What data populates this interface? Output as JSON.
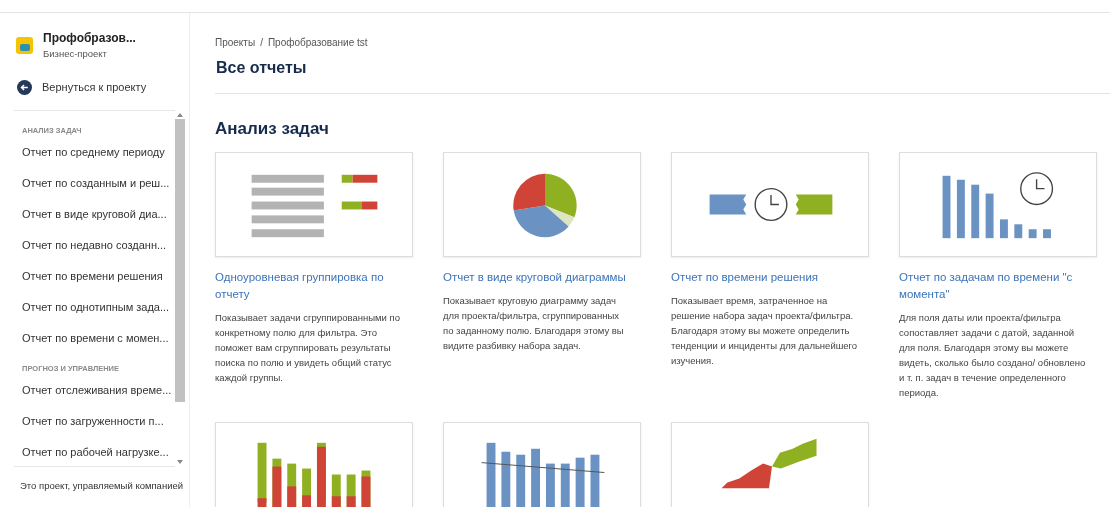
{
  "project": {
    "name": "Профобразов...",
    "type": "Бизнес-проект"
  },
  "back_link": "Вернуться к проекту",
  "sidebar": {
    "sections": [
      {
        "heading": "АНАЛИЗ ЗАДАЧ",
        "items": [
          "Отчет по среднему периоду",
          "Отчет по созданным и реш...",
          "Отчет в виде круговой диа...",
          "Отчет по недавно созданн...",
          "Отчет по времени решения",
          "Отчет по однотипным зада...",
          "Отчет по времени с момен..."
        ]
      },
      {
        "heading": "ПРОГНОЗ И УПРАВЛЕНИЕ",
        "items": [
          "Отчет отслеживания време...",
          "Отчет по загруженности п...",
          "Отчет по рабочей нагрузке..."
        ]
      }
    ],
    "footer": "Это проект, управляемый компанией"
  },
  "breadcrumbs": [
    "Проекты",
    "Профобразование tst"
  ],
  "breadcrumb_separator": "/",
  "page_title": "Все отчеты",
  "section_title": "Анализ задач",
  "cards": [
    {
      "kind": "grouping",
      "title": "Одноуровневая группировка по отчету",
      "description": "Показывает задачи сгруппированными по конкретному полю для фильтра. Это поможет вам сгруппировать результаты поиска по полю и увидеть общий статус каждой группы."
    },
    {
      "kind": "pie",
      "title": "Отчет в виде круговой диаграммы",
      "description": "Показывает круговую диаграмму задач для проекта/фильтра, сгруппированных по заданному полю. Благодаря этому вы видите разбивку набора задач."
    },
    {
      "kind": "resolution",
      "title": "Отчет по времени решения",
      "description": "Показывает время, затраченное на решение набора задач проекта/фильтра. Благодаря этому вы можете определить тенденции и инциденты для дальнейшего изучения."
    },
    {
      "kind": "since",
      "title": "Отчет по задачам по времени \"с момента\"",
      "description": "Для поля даты или проекта/фильтра сопоставляет задачи с датой, заданной для поля. Благодаря этому вы можете видеть, сколько было создано/ обновлено и т. п. задач в течение определенного периода."
    },
    {
      "kind": "stacked"
    },
    {
      "kind": "trend"
    },
    {
      "kind": "area"
    }
  ]
}
